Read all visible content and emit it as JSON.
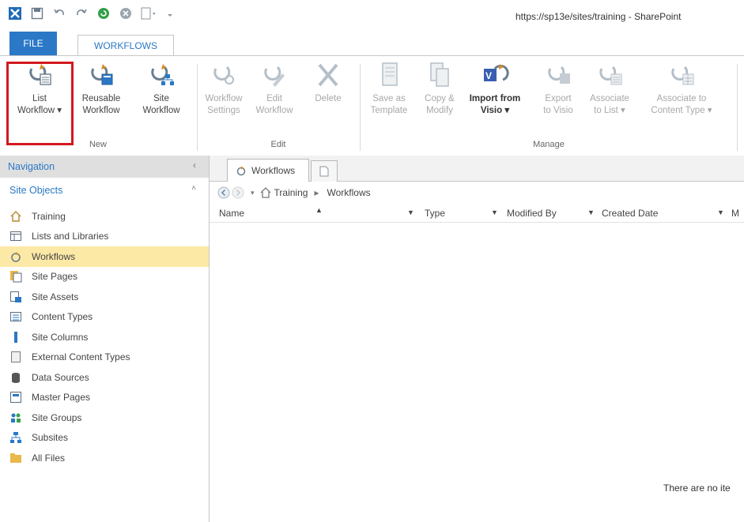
{
  "titlebar": {
    "url": "https://sp13e/sites/training - SharePoint"
  },
  "tabs": {
    "file": "FILE",
    "workflows": "WORKFLOWS"
  },
  "ribbon": {
    "groups": {
      "new": "New",
      "edit": "Edit",
      "manage": "Manage"
    },
    "buttons": {
      "list_workflow": [
        "List",
        "Workflow ▾"
      ],
      "reusable_workflow": [
        "Reusable",
        "Workflow"
      ],
      "site_workflow": [
        "Site",
        "Workflow"
      ],
      "workflow_settings": [
        "Workflow",
        "Settings"
      ],
      "edit_workflow": [
        "Edit",
        "Workflow"
      ],
      "delete": [
        "Delete",
        ""
      ],
      "save_as_template": [
        "Save as",
        "Template"
      ],
      "copy_modify": [
        "Copy &",
        "Modify"
      ],
      "import_visio": [
        "Import from",
        "Visio ▾"
      ],
      "export_visio": [
        "Export",
        "to Visio"
      ],
      "associate_list": [
        "Associate",
        "to List ▾"
      ],
      "associate_ct": [
        "Associate to",
        "Content Type ▾"
      ]
    }
  },
  "nav": {
    "header": "Navigation",
    "section": "Site Objects",
    "items": [
      {
        "label": "Training",
        "icon": "home-icon"
      },
      {
        "label": "Lists and Libraries",
        "icon": "list-icon"
      },
      {
        "label": "Workflows",
        "icon": "workflow-icon",
        "selected": true
      },
      {
        "label": "Site Pages",
        "icon": "pages-icon"
      },
      {
        "label": "Site Assets",
        "icon": "assets-icon"
      },
      {
        "label": "Content Types",
        "icon": "content-types-icon"
      },
      {
        "label": "Site Columns",
        "icon": "columns-icon"
      },
      {
        "label": "External Content Types",
        "icon": "external-icon"
      },
      {
        "label": "Data Sources",
        "icon": "database-icon"
      },
      {
        "label": "Master Pages",
        "icon": "master-pages-icon"
      },
      {
        "label": "Site Groups",
        "icon": "groups-icon"
      },
      {
        "label": "Subsites",
        "icon": "subsites-icon"
      },
      {
        "label": "All Files",
        "icon": "folder-icon"
      }
    ]
  },
  "doc": {
    "tab_label": "Workflows",
    "breadcrumb": {
      "site": "Training",
      "sep": "▸",
      "page": "Workflows"
    },
    "columns": [
      "Name",
      "Type",
      "Modified By",
      "Created Date",
      "M"
    ],
    "empty_message": "There are no ite"
  },
  "colors": {
    "accent": "#2b78c6",
    "selected": "#fde9a6",
    "highlight_box": "#d3191f"
  }
}
